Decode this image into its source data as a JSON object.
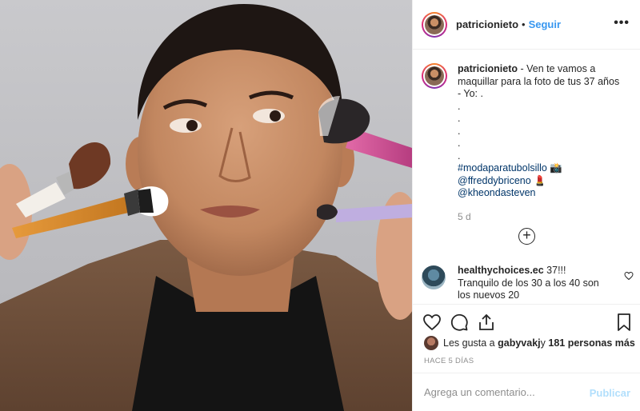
{
  "header": {
    "username": "patricionieto",
    "separator": "•",
    "follow_label": "Seguir",
    "more_icon": "more-dots-icon"
  },
  "caption": {
    "username": "patricionieto",
    "text": " - Ven te vamos a maquillar para la foto de tus 37 años",
    "line2": "- Yo: .",
    "dots": [
      ".",
      ".",
      ".",
      ".",
      "."
    ],
    "tags": [
      "#modaparatubolsillo 📸",
      "@ffreddybriceno 💄",
      "@kheondasteven"
    ],
    "time": "5 d"
  },
  "load_more_icon": "plus-circle-icon",
  "comment": {
    "username": "healthychoices.ec",
    "text": " 37!!! Tranquilo de los 30 a los 40 son los nuevos 20"
  },
  "actions": {
    "icons": [
      "heart-icon",
      "comment-icon",
      "share-icon",
      "bookmark-icon"
    ]
  },
  "likes": {
    "prefix": "Les gusta a ",
    "user": "gabyvakj",
    "middle": " y ",
    "count": "181 personas más"
  },
  "time_ago": "HACE 5 DÍAS",
  "add_comment": {
    "placeholder": "Agrega un comentario...",
    "publish_label": "Publicar"
  },
  "colors": {
    "link": "#3897f0",
    "publish_disabled": "#b2dffc",
    "tag": "#003569",
    "muted": "#8e8e8e"
  }
}
